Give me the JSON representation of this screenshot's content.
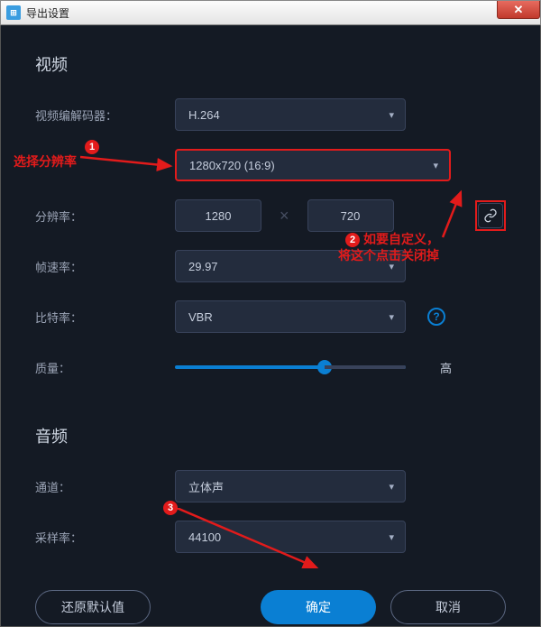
{
  "titlebar": {
    "title": "导出设置"
  },
  "sections": {
    "video": "视频",
    "audio": "音频"
  },
  "labels": {
    "codec": "视频编解码器：",
    "resolution": "分辨率：",
    "framerate": "帧速率：",
    "bitrate": "比特率：",
    "quality": "质量：",
    "channel": "通道：",
    "samplerate": "采样率："
  },
  "values": {
    "codec": "H.264",
    "resolution_preset": "1280x720 (16:9)",
    "width": "1280",
    "height": "720",
    "framerate": "29.97",
    "bitrate": "VBR",
    "quality_label": "高",
    "channel": "立体声",
    "samplerate": "44100"
  },
  "buttons": {
    "restore": "还原默认值",
    "ok": "确定",
    "cancel": "取消"
  },
  "annotations": {
    "a1": "选择分辨率",
    "a2_l1": "如要自定义，",
    "a2_l2": "将这个点击关闭掉"
  }
}
